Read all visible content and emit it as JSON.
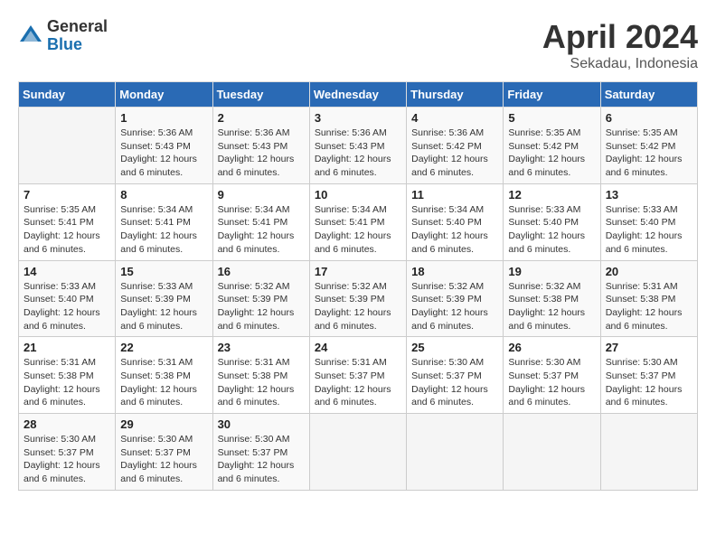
{
  "logo": {
    "general": "General",
    "blue": "Blue"
  },
  "title": "April 2024",
  "subtitle": "Sekadau, Indonesia",
  "days_of_week": [
    "Sunday",
    "Monday",
    "Tuesday",
    "Wednesday",
    "Thursday",
    "Friday",
    "Saturday"
  ],
  "weeks": [
    [
      {
        "num": "",
        "sunrise": "",
        "sunset": "",
        "daylight": ""
      },
      {
        "num": "1",
        "sunrise": "Sunrise: 5:36 AM",
        "sunset": "Sunset: 5:43 PM",
        "daylight": "Daylight: 12 hours and 6 minutes."
      },
      {
        "num": "2",
        "sunrise": "Sunrise: 5:36 AM",
        "sunset": "Sunset: 5:43 PM",
        "daylight": "Daylight: 12 hours and 6 minutes."
      },
      {
        "num": "3",
        "sunrise": "Sunrise: 5:36 AM",
        "sunset": "Sunset: 5:43 PM",
        "daylight": "Daylight: 12 hours and 6 minutes."
      },
      {
        "num": "4",
        "sunrise": "Sunrise: 5:36 AM",
        "sunset": "Sunset: 5:42 PM",
        "daylight": "Daylight: 12 hours and 6 minutes."
      },
      {
        "num": "5",
        "sunrise": "Sunrise: 5:35 AM",
        "sunset": "Sunset: 5:42 PM",
        "daylight": "Daylight: 12 hours and 6 minutes."
      },
      {
        "num": "6",
        "sunrise": "Sunrise: 5:35 AM",
        "sunset": "Sunset: 5:42 PM",
        "daylight": "Daylight: 12 hours and 6 minutes."
      }
    ],
    [
      {
        "num": "7",
        "sunrise": "Sunrise: 5:35 AM",
        "sunset": "Sunset: 5:41 PM",
        "daylight": "Daylight: 12 hours and 6 minutes."
      },
      {
        "num": "8",
        "sunrise": "Sunrise: 5:34 AM",
        "sunset": "Sunset: 5:41 PM",
        "daylight": "Daylight: 12 hours and 6 minutes."
      },
      {
        "num": "9",
        "sunrise": "Sunrise: 5:34 AM",
        "sunset": "Sunset: 5:41 PM",
        "daylight": "Daylight: 12 hours and 6 minutes."
      },
      {
        "num": "10",
        "sunrise": "Sunrise: 5:34 AM",
        "sunset": "Sunset: 5:41 PM",
        "daylight": "Daylight: 12 hours and 6 minutes."
      },
      {
        "num": "11",
        "sunrise": "Sunrise: 5:34 AM",
        "sunset": "Sunset: 5:40 PM",
        "daylight": "Daylight: 12 hours and 6 minutes."
      },
      {
        "num": "12",
        "sunrise": "Sunrise: 5:33 AM",
        "sunset": "Sunset: 5:40 PM",
        "daylight": "Daylight: 12 hours and 6 minutes."
      },
      {
        "num": "13",
        "sunrise": "Sunrise: 5:33 AM",
        "sunset": "Sunset: 5:40 PM",
        "daylight": "Daylight: 12 hours and 6 minutes."
      }
    ],
    [
      {
        "num": "14",
        "sunrise": "Sunrise: 5:33 AM",
        "sunset": "Sunset: 5:40 PM",
        "daylight": "Daylight: 12 hours and 6 minutes."
      },
      {
        "num": "15",
        "sunrise": "Sunrise: 5:33 AM",
        "sunset": "Sunset: 5:39 PM",
        "daylight": "Daylight: 12 hours and 6 minutes."
      },
      {
        "num": "16",
        "sunrise": "Sunrise: 5:32 AM",
        "sunset": "Sunset: 5:39 PM",
        "daylight": "Daylight: 12 hours and 6 minutes."
      },
      {
        "num": "17",
        "sunrise": "Sunrise: 5:32 AM",
        "sunset": "Sunset: 5:39 PM",
        "daylight": "Daylight: 12 hours and 6 minutes."
      },
      {
        "num": "18",
        "sunrise": "Sunrise: 5:32 AM",
        "sunset": "Sunset: 5:39 PM",
        "daylight": "Daylight: 12 hours and 6 minutes."
      },
      {
        "num": "19",
        "sunrise": "Sunrise: 5:32 AM",
        "sunset": "Sunset: 5:38 PM",
        "daylight": "Daylight: 12 hours and 6 minutes."
      },
      {
        "num": "20",
        "sunrise": "Sunrise: 5:31 AM",
        "sunset": "Sunset: 5:38 PM",
        "daylight": "Daylight: 12 hours and 6 minutes."
      }
    ],
    [
      {
        "num": "21",
        "sunrise": "Sunrise: 5:31 AM",
        "sunset": "Sunset: 5:38 PM",
        "daylight": "Daylight: 12 hours and 6 minutes."
      },
      {
        "num": "22",
        "sunrise": "Sunrise: 5:31 AM",
        "sunset": "Sunset: 5:38 PM",
        "daylight": "Daylight: 12 hours and 6 minutes."
      },
      {
        "num": "23",
        "sunrise": "Sunrise: 5:31 AM",
        "sunset": "Sunset: 5:38 PM",
        "daylight": "Daylight: 12 hours and 6 minutes."
      },
      {
        "num": "24",
        "sunrise": "Sunrise: 5:31 AM",
        "sunset": "Sunset: 5:37 PM",
        "daylight": "Daylight: 12 hours and 6 minutes."
      },
      {
        "num": "25",
        "sunrise": "Sunrise: 5:30 AM",
        "sunset": "Sunset: 5:37 PM",
        "daylight": "Daylight: 12 hours and 6 minutes."
      },
      {
        "num": "26",
        "sunrise": "Sunrise: 5:30 AM",
        "sunset": "Sunset: 5:37 PM",
        "daylight": "Daylight: 12 hours and 6 minutes."
      },
      {
        "num": "27",
        "sunrise": "Sunrise: 5:30 AM",
        "sunset": "Sunset: 5:37 PM",
        "daylight": "Daylight: 12 hours and 6 minutes."
      }
    ],
    [
      {
        "num": "28",
        "sunrise": "Sunrise: 5:30 AM",
        "sunset": "Sunset: 5:37 PM",
        "daylight": "Daylight: 12 hours and 6 minutes."
      },
      {
        "num": "29",
        "sunrise": "Sunrise: 5:30 AM",
        "sunset": "Sunset: 5:37 PM",
        "daylight": "Daylight: 12 hours and 6 minutes."
      },
      {
        "num": "30",
        "sunrise": "Sunrise: 5:30 AM",
        "sunset": "Sunset: 5:37 PM",
        "daylight": "Daylight: 12 hours and 6 minutes."
      },
      {
        "num": "",
        "sunrise": "",
        "sunset": "",
        "daylight": ""
      },
      {
        "num": "",
        "sunrise": "",
        "sunset": "",
        "daylight": ""
      },
      {
        "num": "",
        "sunrise": "",
        "sunset": "",
        "daylight": ""
      },
      {
        "num": "",
        "sunrise": "",
        "sunset": "",
        "daylight": ""
      }
    ]
  ]
}
